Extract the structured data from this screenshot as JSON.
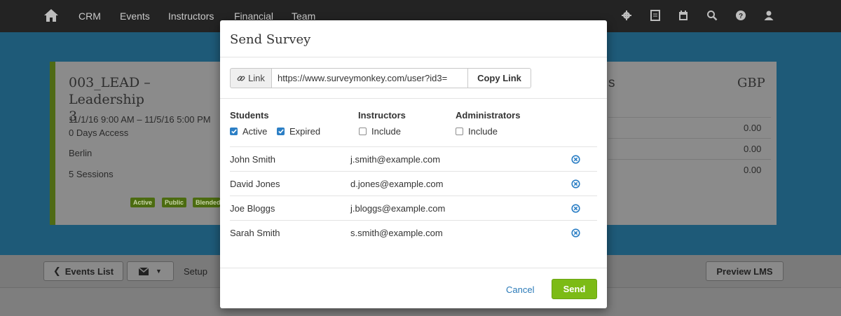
{
  "nav": {
    "items": [
      "CRM",
      "Events",
      "Instructors",
      "Financial",
      "Team"
    ],
    "icons": [
      "gear-icon",
      "document-icon",
      "calendar-icon",
      "search-icon",
      "help-icon",
      "user-icon"
    ]
  },
  "event": {
    "title_line1": "003_LEAD – Leadership",
    "title_line2": "3",
    "dates": "11/1/16 9:00 AM – 11/5/16 5:00 PM",
    "access": "0 Days Access",
    "location": "Berlin",
    "sessions": "5 Sessions",
    "badges": [
      "Active",
      "Public",
      "Blended"
    ],
    "currency": "GBP",
    "partial_label": "s",
    "amounts": [
      "0.00",
      "0.00",
      "0.00"
    ]
  },
  "actionbar": {
    "events_list": "Events List",
    "setup": "Setup",
    "preview_lms": "Preview LMS"
  },
  "modal": {
    "title": "Send Survey",
    "link_label": "Link",
    "link_value": "https://www.surveymonkey.com/user?id3=",
    "copy_label": "Copy Link",
    "groups": {
      "students": {
        "title": "Students",
        "active": "Active",
        "expired": "Expired"
      },
      "instructors": {
        "title": "Instructors",
        "include": "Include"
      },
      "administrators": {
        "title": "Administrators",
        "include": "Include"
      }
    },
    "recipients": [
      {
        "name": "John Smith",
        "email": "j.smith@example.com"
      },
      {
        "name": "David Jones",
        "email": "d.jones@example.com"
      },
      {
        "name": "Joe Bloggs",
        "email": "j.bloggs@example.com"
      },
      {
        "name": "Sarah Smith",
        "email": "s.smith@example.com"
      }
    ],
    "cancel_label": "Cancel",
    "send_label": "Send"
  },
  "colors": {
    "accent_blue": "#2c7fc5",
    "send_green": "#7cbb16",
    "link_blue": "#2a7ab8",
    "nav_bg": "#232323"
  }
}
